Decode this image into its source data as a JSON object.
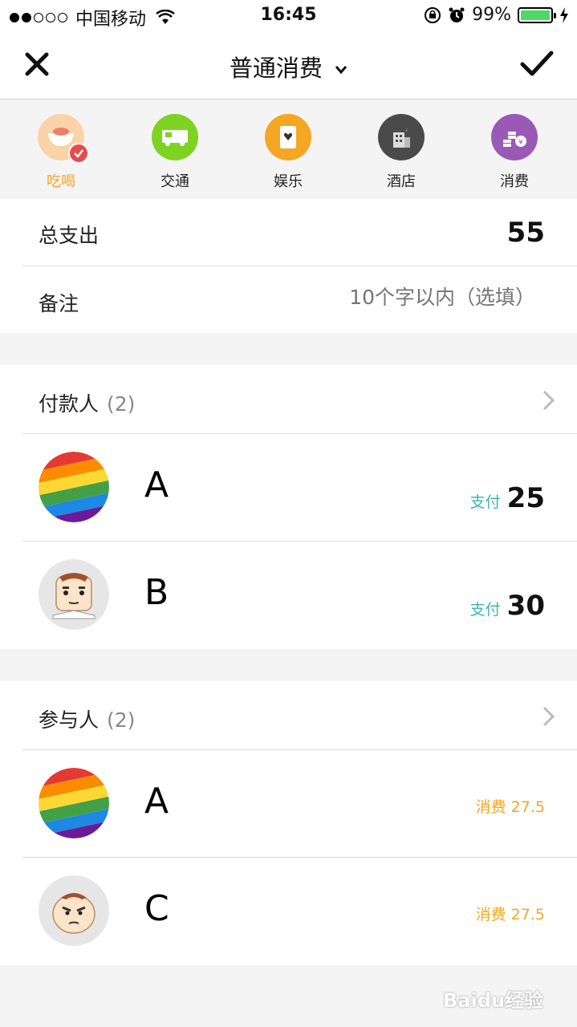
{
  "status_bar": {
    "carrier": "中国移动",
    "time": "16:45",
    "battery": "99%",
    "signal_dots_filled": 2,
    "signal_dots_total": 5
  },
  "nav": {
    "title": "普通消费",
    "close_icon": "close-icon",
    "confirm_icon": "check-icon"
  },
  "categories": [
    {
      "label": "吃喝",
      "icon": "food-icon",
      "color": "#fbd3a8",
      "active": true
    },
    {
      "label": "交通",
      "icon": "bus-icon",
      "color": "#7ed321"
    },
    {
      "label": "娱乐",
      "icon": "card-icon",
      "color": "#f5a623"
    },
    {
      "label": "酒店",
      "icon": "hotel-icon",
      "color": "#4a4a4a"
    },
    {
      "label": "消费",
      "icon": "coins-icon",
      "color": "#9b59b6"
    }
  ],
  "summary": {
    "total_label": "总支出",
    "total_value": "55",
    "note_label": "备注",
    "note_placeholder": "10个字以内（选填）"
  },
  "payers": {
    "label": "付款人",
    "count": "(2)",
    "items": [
      {
        "name": "A",
        "pay_label": "支付",
        "amount": "25",
        "avatar": "rainbow-avatar"
      },
      {
        "name": "B",
        "pay_label": "支付",
        "amount": "30",
        "avatar": "cartoon-avatar"
      }
    ]
  },
  "participants": {
    "label": "参与人",
    "count": "(2)",
    "items": [
      {
        "name": "A",
        "consume": "消费 27.5",
        "avatar": "rainbow-avatar"
      },
      {
        "name": "C",
        "consume": "消费 27.5",
        "avatar": "cartoon-avatar"
      }
    ]
  },
  "watermark": "Baidu经验"
}
